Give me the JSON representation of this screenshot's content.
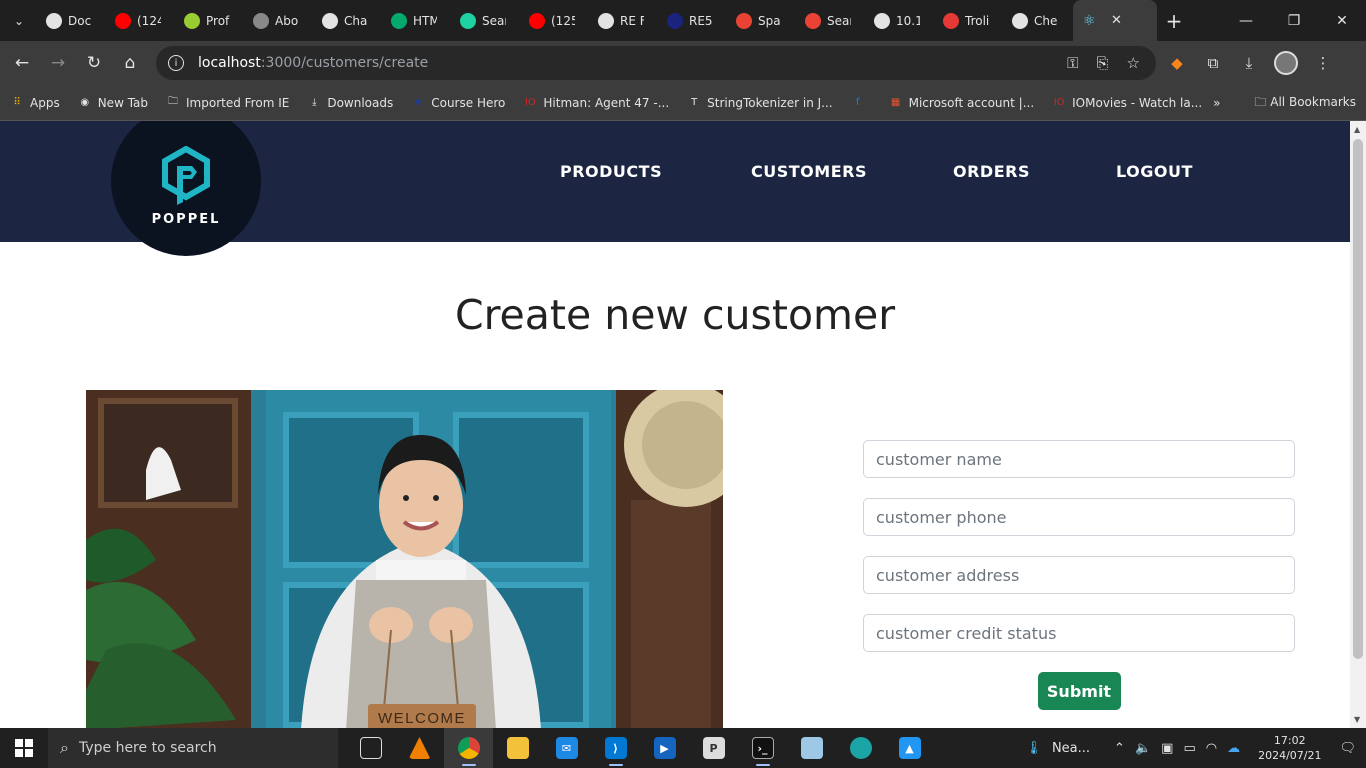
{
  "browser": {
    "tabs": [
      {
        "label": "Doc",
        "icon": "github-icon",
        "color": "#e3e3e3"
      },
      {
        "label": "(124",
        "icon": "youtube-icon",
        "color": "#ff0000"
      },
      {
        "label": "Prof",
        "icon": "pluralsight-icon",
        "color": "#9acd32"
      },
      {
        "label": "Abo",
        "icon": "avatar-icon",
        "color": "#888888"
      },
      {
        "label": "Cha",
        "icon": "chatgpt-icon",
        "color": "#e3e3e3"
      },
      {
        "label": "HTM",
        "icon": "w3schools-icon",
        "color": "#04aa6d"
      },
      {
        "label": "Sear",
        "icon": "vuetify-icon",
        "color": "#1dd1a1"
      },
      {
        "label": "(125",
        "icon": "youtube-icon",
        "color": "#ff0000"
      },
      {
        "label": "RE F",
        "icon": "github-icon",
        "color": "#e3e3e3"
      },
      {
        "label": "RE5",
        "icon": "capcom-icon",
        "color": "#1a237e"
      },
      {
        "label": "Spa",
        "icon": "gmail-icon",
        "color": "#ea4335"
      },
      {
        "label": "Sear",
        "icon": "gmail-icon",
        "color": "#ea4335"
      },
      {
        "label": "10.1",
        "icon": "github-icon",
        "color": "#e3e3e3"
      },
      {
        "label": "Troli",
        "icon": "troli-icon",
        "color": "#e53935"
      },
      {
        "label": "Che",
        "icon": "github-icon",
        "color": "#e3e3e3"
      }
    ],
    "active_tab": {
      "icon": "react-icon",
      "color": "#61dafb"
    },
    "address": {
      "host": "localhost",
      "path": ":3000/customers/create"
    },
    "bookmarks": [
      {
        "label": "Apps",
        "icon": "apps-grid-icon"
      },
      {
        "label": "New Tab",
        "icon": "github-icon"
      },
      {
        "label": "Imported From IE",
        "icon": "folder-icon"
      },
      {
        "label": "Downloads",
        "icon": "download-icon"
      },
      {
        "label": "Course Hero",
        "icon": "course-hero-icon"
      },
      {
        "label": "Hitman: Agent 47 -...",
        "icon": "io-icon"
      },
      {
        "label": "StringTokenizer in J...",
        "icon": "t-icon"
      },
      {
        "label": "",
        "icon": "facebook-icon"
      },
      {
        "label": "Microsoft account |...",
        "icon": "microsoft-icon"
      },
      {
        "label": "IOMovies - Watch la...",
        "icon": "io-icon"
      }
    ],
    "all_bookmarks": "All Bookmarks"
  },
  "page": {
    "logo_text": "POPPEL",
    "nav": {
      "products": "PRODUCTS",
      "customers": "CUSTOMERS",
      "orders": "ORDERS",
      "logout": "LOGOUT"
    },
    "title": "Create new customer",
    "photo_sign": "WELCOME",
    "form": {
      "name_placeholder": "customer name",
      "phone_placeholder": "customer phone",
      "address_placeholder": "customer address",
      "credit_placeholder": "customer credit status",
      "submit_label": "Submit"
    }
  },
  "taskbar": {
    "search_placeholder": "Type here to search",
    "weather": "Nea...",
    "time": "17:02",
    "date": "2024/07/21"
  }
}
